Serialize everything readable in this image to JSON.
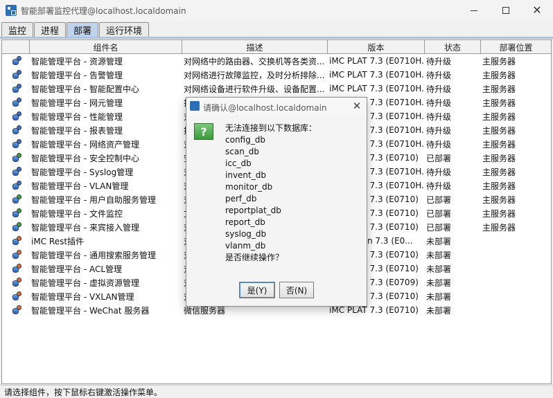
{
  "window": {
    "title": "智能部署监控代理@localhost.localdomain"
  },
  "tabs": [
    "监控",
    "进程",
    "部署",
    "运行环境"
  ],
  "active_tab": "部署",
  "table": {
    "headers": [
      "组件名",
      "描述",
      "版本",
      "状态",
      "部署位置"
    ],
    "rows": [
      {
        "name": "智能管理平台 - 资源管理",
        "desc": "对网络中的路由器、交换机等各类资...",
        "ver": "iMC PLAT 7.3 (E0710H...",
        "status": "待升级",
        "loc": "主服务器",
        "dot": "#3f6fc6"
      },
      {
        "name": "智能管理平台 - 告警管理",
        "desc": "对网络进行故障监控，及时分析排除...",
        "ver": "iMC PLAT 7.3 (E0710H...",
        "status": "待升级",
        "loc": "主服务器",
        "dot": "#3f6fc6"
      },
      {
        "name": "智能管理平台 - 智能配置中心",
        "desc": "对网络设备进行软件升级、设备配置...",
        "ver": "iMC PLAT 7.3 (E0710H...",
        "status": "待升级",
        "loc": "主服务器",
        "dot": "#3f6fc6"
      },
      {
        "name": "智能管理平台 - 网元管理",
        "desc": "提",
        "ver": "iMC PLAT 7.3 (E0710H...",
        "status": "待升级",
        "loc": "主服务器",
        "dot": "#3f6fc6"
      },
      {
        "name": "智能管理平台 - 性能管理",
        "desc": "对",
        "ver": "iMC PLAT 7.3 (E0710H...",
        "status": "待升级",
        "loc": "主服务器",
        "dot": "#3f6fc6"
      },
      {
        "name": "智能管理平台 - 报表管理",
        "desc": "提",
        "ver": "iMC PLAT 7.3 (E0710H...",
        "status": "待升级",
        "loc": "主服务器",
        "dot": "#3f6fc6"
      },
      {
        "name": "智能管理平台 - 网络资产管理",
        "desc": "对",
        "ver": "iMC PLAT 7.3 (E0710H...",
        "status": "待升级",
        "loc": "主服务器",
        "dot": "#3f6fc6"
      },
      {
        "name": "智能管理平台 - 安全控制中心",
        "desc": "安",
        "ver": "iMC PLAT 7.3 (E0710)",
        "status": "已部署",
        "loc": "主服务器",
        "dot": "#3da23d"
      },
      {
        "name": "智能管理平台 - Syslog管理",
        "desc": "对",
        "ver": "iMC PLAT 7.3 (E0710H...",
        "status": "待升级",
        "loc": "主服务器",
        "dot": "#3f6fc6"
      },
      {
        "name": "智能管理平台 - VLAN管理",
        "desc": "对",
        "ver": "iMC PLAT 7.3 (E0710H...",
        "status": "待升级",
        "loc": "主服务器",
        "dot": "#3f6fc6"
      },
      {
        "name": "智能管理平台 - 用户自助服务管理",
        "desc": "对",
        "ver": "iMC PLAT 7.3 (E0710)",
        "status": "已部署",
        "loc": "主服务器",
        "dot": "#3da23d"
      },
      {
        "name": "智能管理平台 - 文件监控",
        "desc": "文",
        "ver": "iMC PLAT 7.3 (E0710)",
        "status": "已部署",
        "loc": "主服务器",
        "dot": "#3da23d"
      },
      {
        "name": "智能管理平台 - 来宾接入管理",
        "desc": "对",
        "ver": "iMC PLAT 7.3 (E0710)",
        "status": "已部署",
        "loc": "主服务器",
        "dot": "#3da23d"
      },
      {
        "name": "iMC Rest插件",
        "desc": "对",
        "ver": "iMC Plugin 7.3 (E0...",
        "status": "未部署",
        "loc": "",
        "dot": "#e06b43"
      },
      {
        "name": "智能管理平台 - 通用搜索服务管理",
        "desc": "对",
        "ver": "iMC PLAT 7.3 (E0710)",
        "status": "未部署",
        "loc": "",
        "dot": "#e06b43"
      },
      {
        "name": "智能管理平台 - ACL管理",
        "desc": "对",
        "ver": "iMC PLAT 7.3 (E0710)",
        "status": "未部署",
        "loc": "",
        "dot": "#e06b43"
      },
      {
        "name": "智能管理平台 - 虚拟资源管理",
        "desc": "对",
        "ver": "iMC PLAT 7.3 (E0709)",
        "status": "未部署",
        "loc": "",
        "dot": "#e06b43"
      },
      {
        "name": "智能管理平台 - VXLAN管理",
        "desc": "对",
        "ver": "iMC PLAT 7.3 (E0710)",
        "status": "未部署",
        "loc": "",
        "dot": "#e06b43"
      },
      {
        "name": "智能管理平台 - WeChat 服务器",
        "desc": "微信服务器",
        "ver": "iMC PLAT 7.3 (E0710)",
        "status": "未部署",
        "loc": "",
        "dot": "#e06b43"
      }
    ]
  },
  "statusbar": {
    "text": "请选择组件，按下鼠标右键激活操作菜单。"
  },
  "dialog": {
    "title": "请确认@localhost.localdomain",
    "icon": "?",
    "lines": [
      "无法连接到以下数据库：",
      "config_db",
      "scan_db",
      "icc_db",
      "invent_db",
      "monitor_db",
      "perf_db",
      "reportplat_db",
      "report_db",
      "syslog_db",
      "vlanm_db",
      "是否继续操作？"
    ],
    "yes_label": "是(Y)",
    "no_label": "否(N)"
  }
}
